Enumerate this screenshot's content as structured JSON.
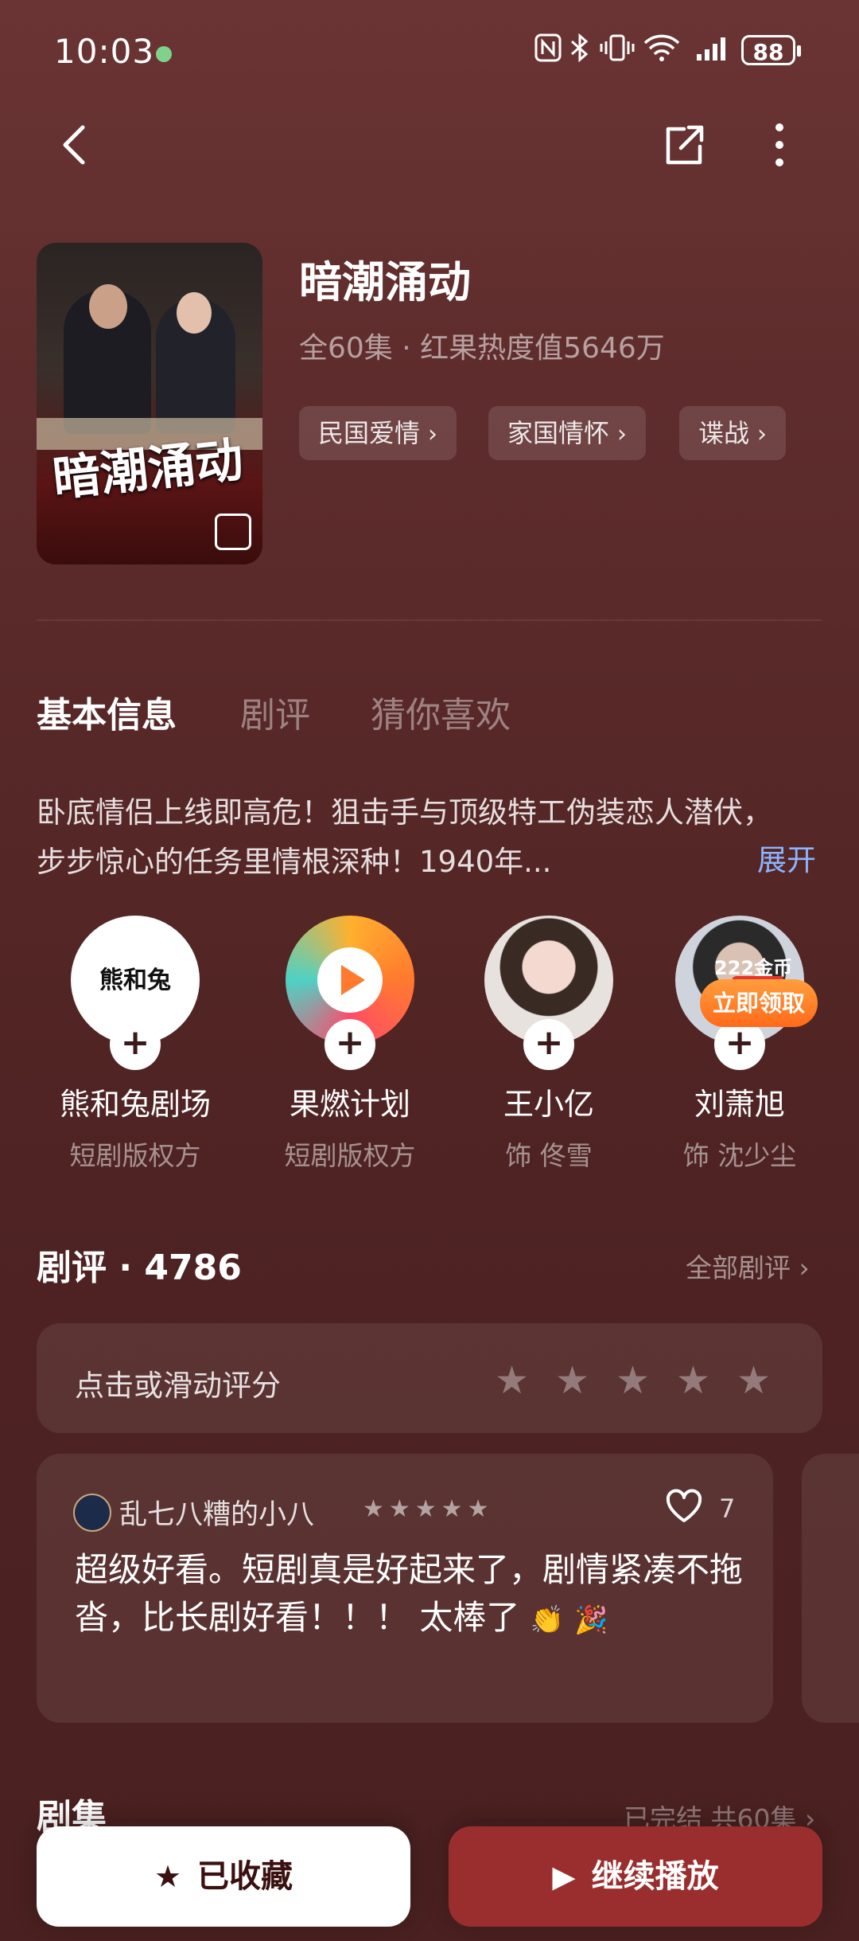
{
  "status": {
    "time": "10:03",
    "battery": "88"
  },
  "drama": {
    "title": "暗潮涌动",
    "meta": "全60集 · 红果热度值5646万",
    "poster_title": "暗潮涌动",
    "tags": [
      "民国爱情",
      "家国情怀",
      "谍战"
    ]
  },
  "tabs": [
    "基本信息",
    "剧评",
    "猜你喜欢"
  ],
  "description": {
    "text": "卧底情侣上线即高危！狙击手与顶级特工伪装恋人潜伏，步步惊心的任务里情根深种！1940年...",
    "expand": "展开"
  },
  "people": [
    {
      "name": "熊和兔剧场",
      "role": "短剧版权方",
      "avatar_text": "熊和兔"
    },
    {
      "name": "果燃计划",
      "role": "短剧版权方"
    },
    {
      "name": "王小亿",
      "role": "饰 佟雪"
    },
    {
      "name": "刘萧旭",
      "role": "饰 沈少尘"
    }
  ],
  "coin_promo": {
    "amount": "222金币",
    "label": "立即领取"
  },
  "reviews": {
    "header": "剧评 · 4786",
    "all": "全部剧评 ›",
    "rate_prompt": "点击或滑动评分",
    "items": [
      {
        "user": "乱七八糟的小八",
        "stars": "★★★★★",
        "likes": "7",
        "text": "超级好看。短剧真是好起来了，剧情紧凑不拖沓，比长剧好看！！！ 太棒了"
      }
    ]
  },
  "episodes": {
    "title": "剧集",
    "status": "已完结 共60集 ›"
  },
  "actions": {
    "favorite": "已收藏",
    "play": "继续播放"
  },
  "colors": {
    "accent": "#9a2e2e",
    "link": "#8cb4ff",
    "coin": "#ff7a22"
  }
}
